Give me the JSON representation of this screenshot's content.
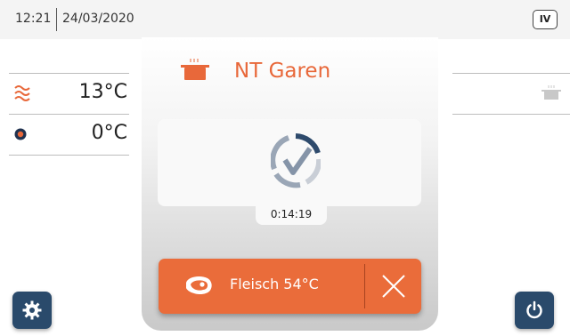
{
  "status_bar": {
    "time": "12:21",
    "date": "24/03/2020",
    "level_badge": "IV"
  },
  "left_panel": {
    "rows": [
      {
        "icon": "heat-waves-icon",
        "value": "13°C"
      },
      {
        "icon": "core-probe-icon",
        "value": "0°C"
      }
    ]
  },
  "right_panel": {
    "icon": "pot-icon"
  },
  "program": {
    "icon": "pot-icon",
    "title": "NT Garen",
    "status_icon": "check-progress-icon",
    "timer": "0:14:19"
  },
  "action": {
    "icon": "meat-icon",
    "label": "Fleisch 54°C",
    "cancel_icon": "close-icon"
  },
  "buttons": {
    "settings_icon": "gear-icon",
    "power_icon": "power-icon"
  },
  "colors": {
    "accent": "#ea6c3a",
    "button_blue": "#2a4a6b",
    "probe_blue": "#20324f"
  }
}
